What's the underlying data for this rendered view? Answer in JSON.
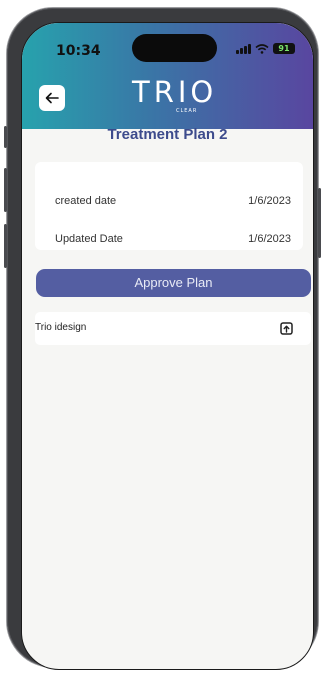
{
  "status_bar": {
    "time": "10:34",
    "battery": "91"
  },
  "header": {
    "logo_text": "TRIO",
    "logo_sub": "CLEAR"
  },
  "page": {
    "title": "Treatment Plan 2"
  },
  "info": [
    {
      "label": "created date",
      "value": "1/6/2023"
    },
    {
      "label": "Updated Date",
      "value": "1/6/2023"
    }
  ],
  "actions": {
    "approve_label": "Approve Plan"
  },
  "files": [
    {
      "name": "Trio idesign",
      "icon": "upload-icon"
    }
  ],
  "colors": {
    "header_start": "#27a2ad",
    "header_end": "#5946a0",
    "accent": "#545ea2",
    "title": "#3d4b8c"
  }
}
